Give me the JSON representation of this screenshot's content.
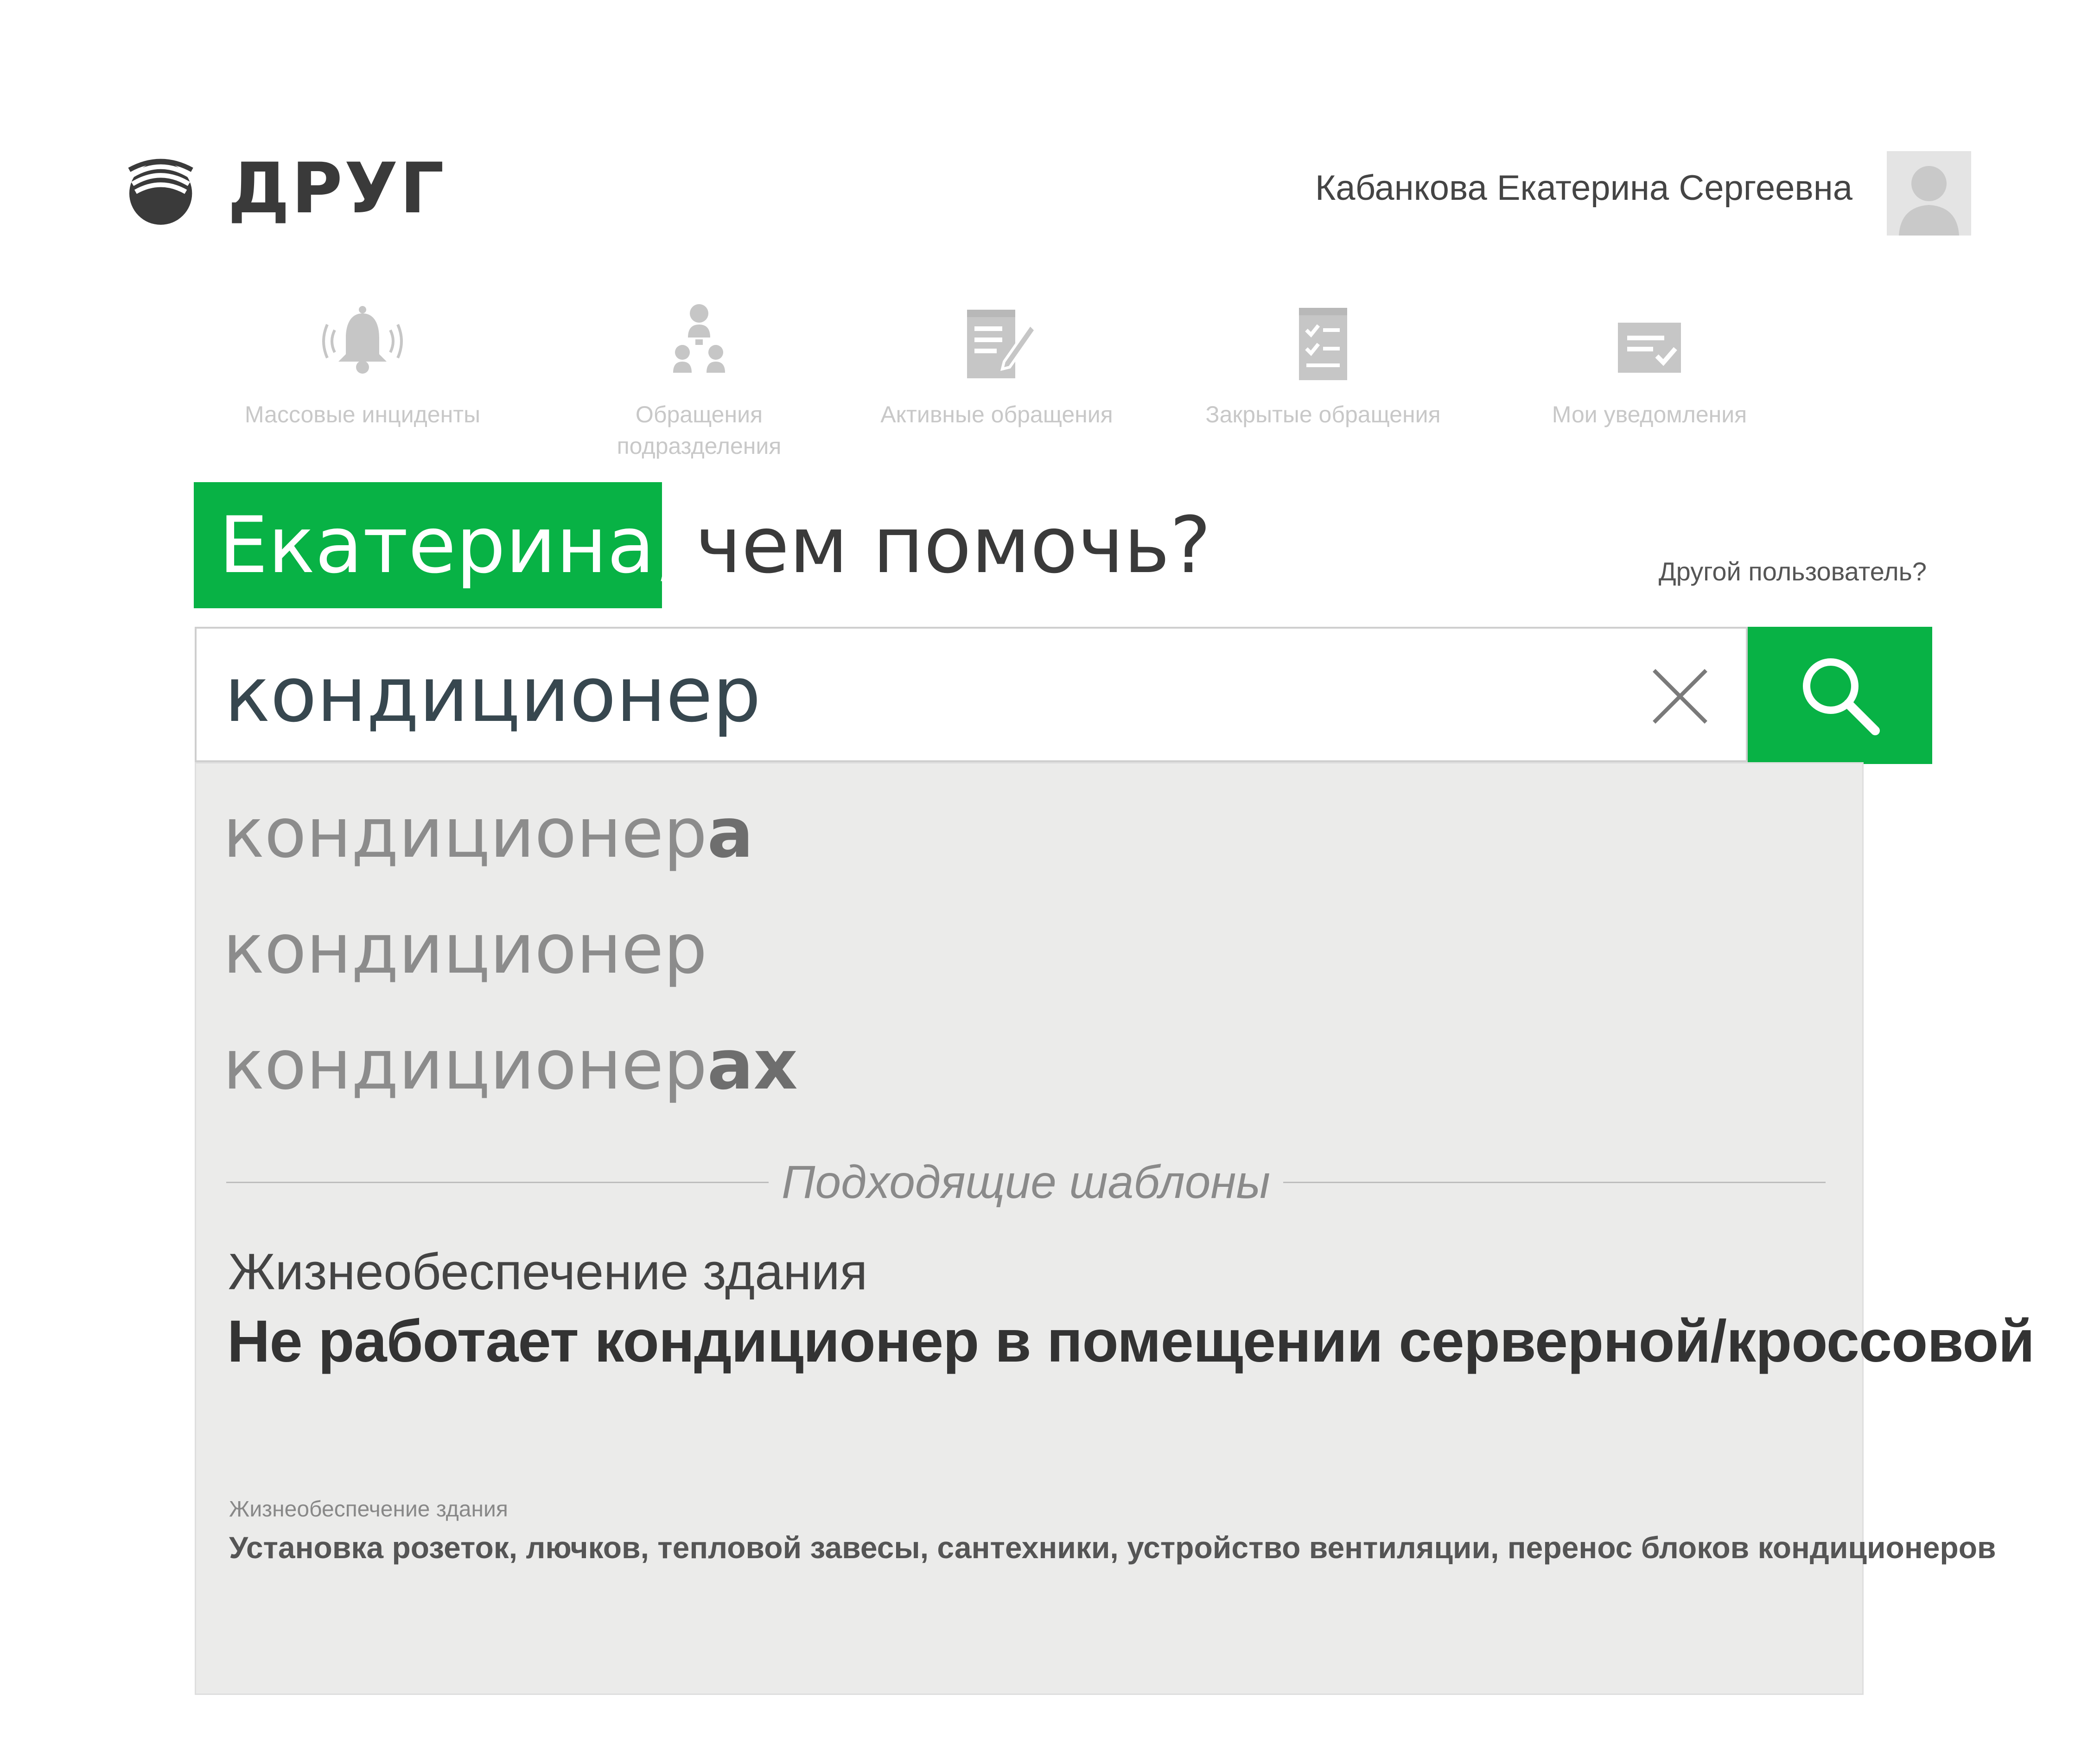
{
  "app": {
    "logo_text": "ДРУГ",
    "user_name": "Кабанкова Екатерина Сергеевна"
  },
  "nav": {
    "items": [
      {
        "label": "Массовые инциденты",
        "icon": "bell-alarm-icon"
      },
      {
        "label": "Обращения подразделения",
        "icon": "people-group-icon"
      },
      {
        "label": "Активные обращения",
        "icon": "edit-document-icon"
      },
      {
        "label": "Закрытые обращения",
        "icon": "checklist-icon"
      },
      {
        "label": "Мои уведомления",
        "icon": "notification-check-icon"
      }
    ]
  },
  "greeting": {
    "name": "Екатерина,",
    "rest": "чем помочь?",
    "other_user_link": "Другой пользователь?"
  },
  "search": {
    "value": "кондиционер"
  },
  "suggestions": [
    {
      "base": "кондиционер",
      "suffix": "а"
    },
    {
      "base": "кондиционер",
      "suffix": ""
    },
    {
      "base": "кондиционер",
      "suffix": "ах"
    }
  ],
  "templates": {
    "title": "Подходящие шаблоны",
    "items": [
      {
        "category": "Жизнеобеспечение здания",
        "title": "Не работает кондиционер в помещении серверной/кроссовой"
      },
      {
        "category": "Жизнеобеспечение здания",
        "title": "Установка розеток, лючков, тепловой завесы, сантехники, устройство вентиляции, перенос блоков кондиционеров"
      }
    ]
  },
  "colors": {
    "accent": "#08b245",
    "nav_icon": "#c6c6c6",
    "dropdown_bg": "#ebebea"
  }
}
